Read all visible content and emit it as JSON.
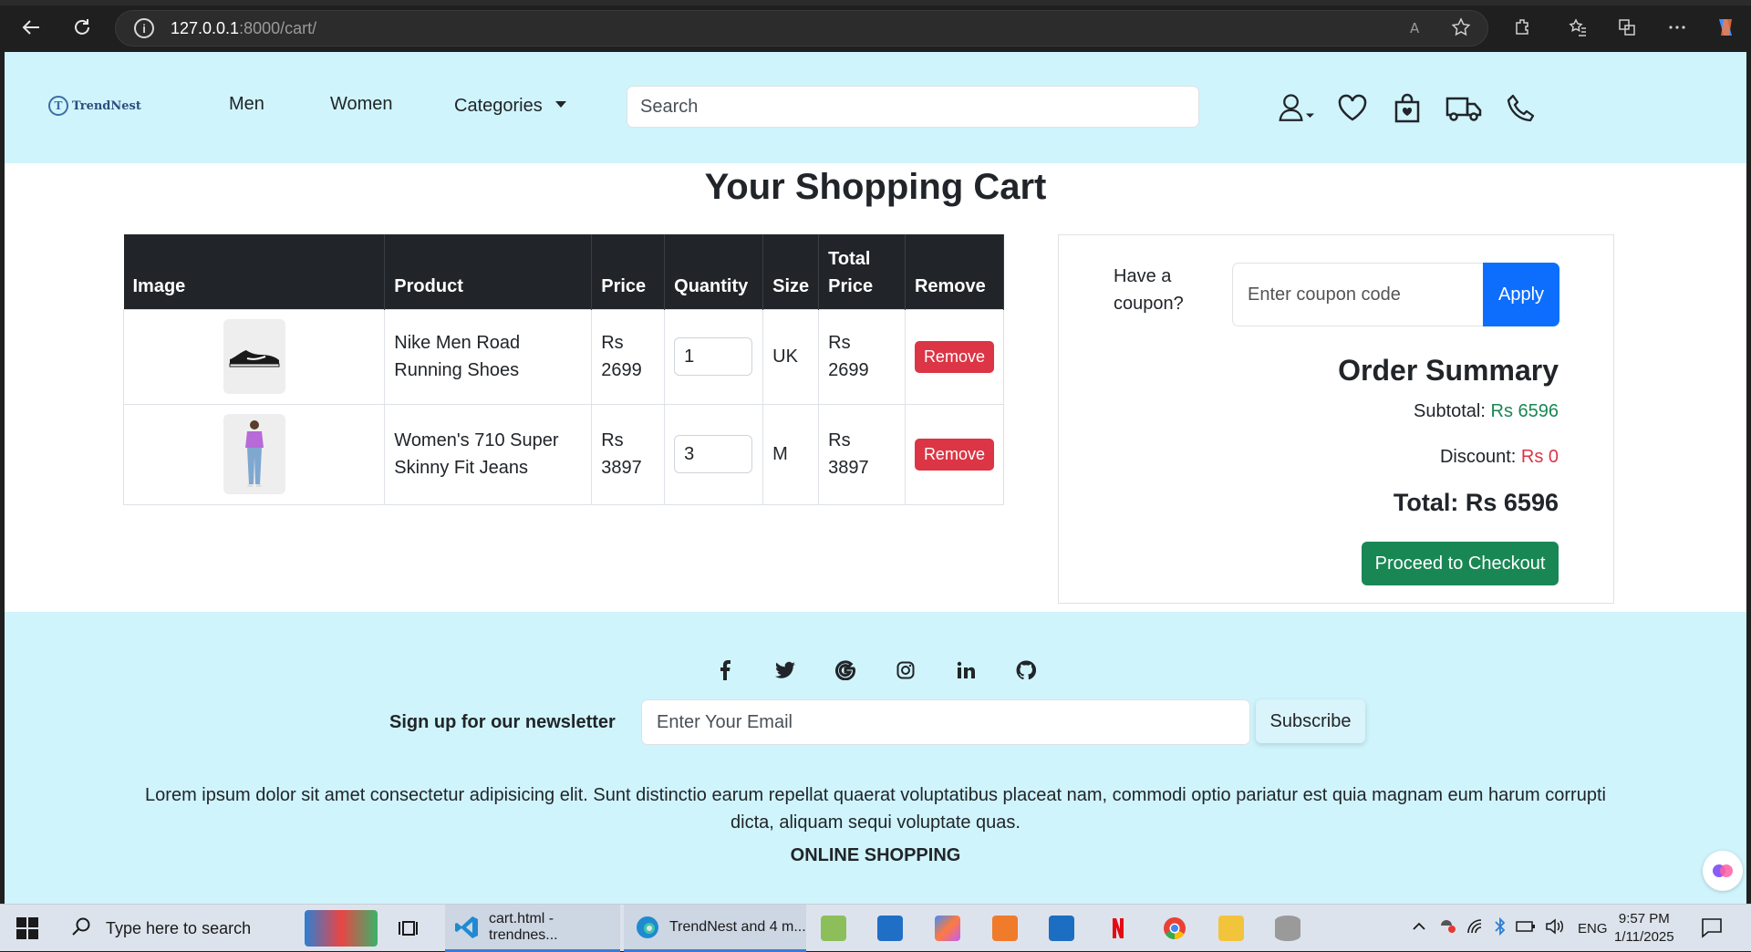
{
  "browser": {
    "url_host": "127.0.0.1",
    "url_rest": ":8000/cart/"
  },
  "header": {
    "logo_letter": "T",
    "logo_text": "TrendNest",
    "nav": [
      "Men",
      "Women",
      "Categories"
    ],
    "search_placeholder": "Search"
  },
  "cart": {
    "title": "Your Shopping Cart",
    "columns": [
      "Image",
      "Product",
      "Price",
      "Quantity",
      "Size",
      "Total Price",
      "Remove"
    ],
    "rows": [
      {
        "product": "Nike Men Road Running Shoes",
        "price": "Rs 2699",
        "quantity": "1",
        "size": "UK",
        "total": "Rs 2699",
        "remove": "Remove"
      },
      {
        "product": "Women's 710 Super Skinny Fit Jeans",
        "price": "Rs 3897",
        "quantity": "3",
        "size": "M",
        "total": "Rs 3897",
        "remove": "Remove"
      }
    ]
  },
  "summary": {
    "coupon_label": "Have a coupon?",
    "coupon_placeholder": "Enter coupon code",
    "apply": "Apply",
    "title": "Order Summary",
    "subtotal_label": "Subtotal:",
    "subtotal_value": "Rs 6596",
    "discount_label": "Discount:",
    "discount_value": "Rs 0",
    "total": "Total: Rs 6596",
    "checkout": "Proceed to Checkout"
  },
  "footer": {
    "social": [
      "facebook-icon",
      "twitter-icon",
      "google-icon",
      "instagram-icon",
      "linkedin-icon",
      "github-icon"
    ],
    "newsletter_label": "Sign up for our newsletter",
    "email_placeholder": "Enter Your Email",
    "subscribe": "Subscribe",
    "lorem": "Lorem ipsum dolor sit amet consectetur adipisicing elit. Sunt distinctio earum repellat quaerat voluptatibus placeat nam, commodi optio pariatur est quia magnam eum harum corrupti dicta, aliquam sequi voluptate quas.",
    "online_heading": "ONLINE SHOPPING"
  },
  "taskbar": {
    "search_text": "Type here to search",
    "app_vscode": "cart.html - trendnes...",
    "app_edge": "TrendNest and 4 m...",
    "lang": "ENG",
    "time": "9:57 PM",
    "date": "1/11/2025"
  },
  "colors": {
    "header_bg": "#cff4fc",
    "primary": "#0d6efd",
    "success": "#198754",
    "danger": "#dc3545",
    "dark": "#212529"
  }
}
